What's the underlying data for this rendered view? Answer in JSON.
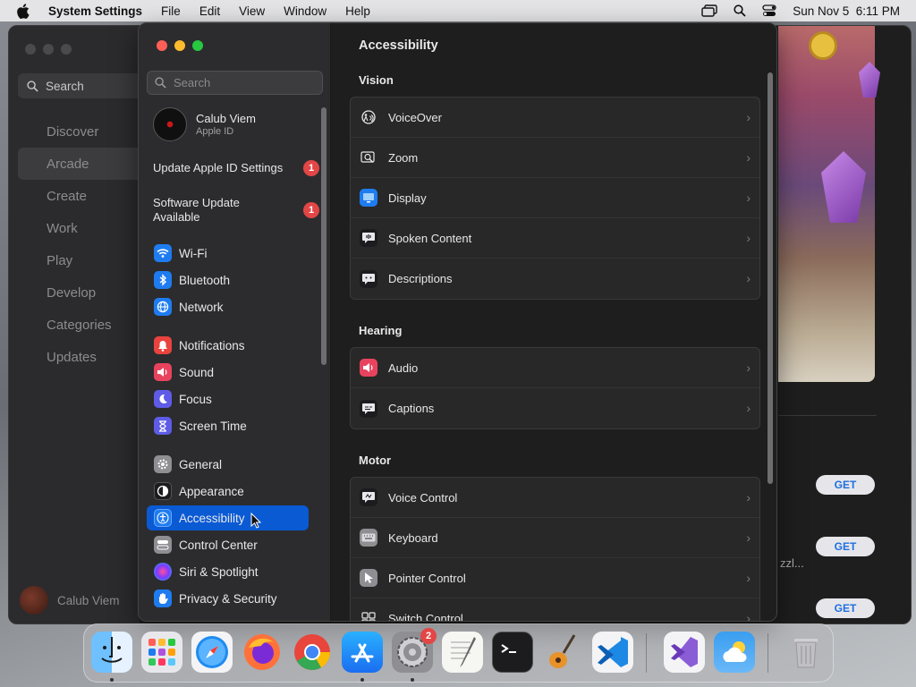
{
  "menubar": {
    "app_name": "System Settings",
    "menus": [
      "File",
      "Edit",
      "View",
      "Window",
      "Help"
    ],
    "datetime": "Sun Nov 5  6:11 PM"
  },
  "appstore": {
    "search_label": "Search",
    "nav": [
      "Discover",
      "Arcade",
      "Create",
      "Work",
      "Play",
      "Develop",
      "Categories",
      "Updates"
    ],
    "active_nav": "Arcade",
    "user_name": "Calub Viem",
    "get_label": "GET",
    "partial_text": "zzl..."
  },
  "settings": {
    "search_placeholder": "Search",
    "user": {
      "name": "Calub Viem",
      "subtitle": "Apple ID"
    },
    "notices": [
      {
        "label": "Update Apple ID Settings",
        "badge": "1"
      },
      {
        "label": "Software Update Available",
        "badge": "1"
      }
    ],
    "nav": {
      "wifi": "Wi-Fi",
      "bluetooth": "Bluetooth",
      "network": "Network",
      "notifications": "Notifications",
      "sound": "Sound",
      "focus": "Focus",
      "screen_time": "Screen Time",
      "general": "General",
      "appearance": "Appearance",
      "accessibility": "Accessibility",
      "control_center": "Control Center",
      "siri": "Siri & Spotlight",
      "privacy": "Privacy & Security"
    },
    "selected_nav": "Accessibility",
    "content": {
      "title": "Accessibility",
      "vision_title": "Vision",
      "vision": [
        "VoiceOver",
        "Zoom",
        "Display",
        "Spoken Content",
        "Descriptions"
      ],
      "hearing_title": "Hearing",
      "hearing": [
        "Audio",
        "Captions"
      ],
      "motor_title": "Motor",
      "motor": [
        "Voice Control",
        "Keyboard",
        "Pointer Control",
        "Switch Control"
      ]
    }
  },
  "dock": {
    "apps": [
      "Finder",
      "Launchpad",
      "Safari",
      "Firefox",
      "Chrome",
      "App Store",
      "System Settings",
      "TextEdit",
      "Terminal",
      "GarageBand",
      "Visual Studio Code",
      "Visual Studio",
      "Weather",
      "Trash"
    ],
    "settings_badge": "2"
  },
  "colors": {
    "selection": "#0a5ad4",
    "badge": "#e24646",
    "traffic_red": "#ff5f57",
    "traffic_yellow": "#febc2e",
    "traffic_green": "#28c840"
  }
}
